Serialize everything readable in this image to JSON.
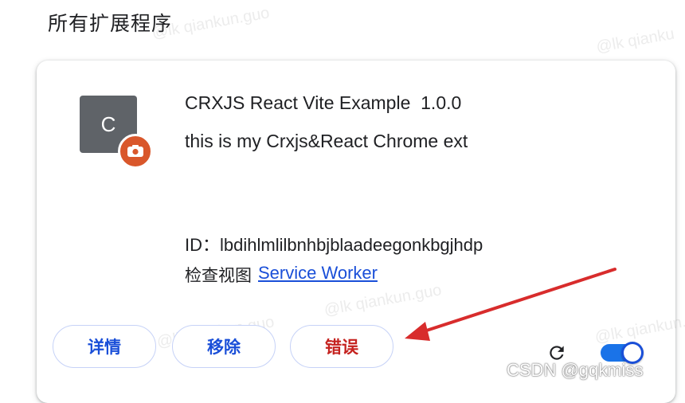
{
  "section_title": "所有扩展程序",
  "extension": {
    "icon_letter": "C",
    "name": "CRXJS React Vite Example  1.0.0",
    "description": "this is my Crxjs&React Chrome ext",
    "id_text": "ID：lbdihlmlilbnhbjblaadeegonkbgjhdp",
    "inspect_label": "检查视图",
    "inspect_link": "Service Worker"
  },
  "buttons": {
    "details": "详情",
    "remove": "移除",
    "errors": "错误"
  },
  "controls": {
    "reload_icon": "reload-icon",
    "enabled": true
  },
  "colors": {
    "accent": "#1a4fd8",
    "error": "#c5221f",
    "badge": "#d9572b",
    "arrow": "#d82c2c"
  },
  "watermarks": [
    "@lk qiankun.guo",
    "@lk qiankun.guo",
    "@lk qiankun.guo",
    "@lk qiankun.guo",
    "@lk qianku"
  ],
  "credit": "CSDN @gqkmiss"
}
